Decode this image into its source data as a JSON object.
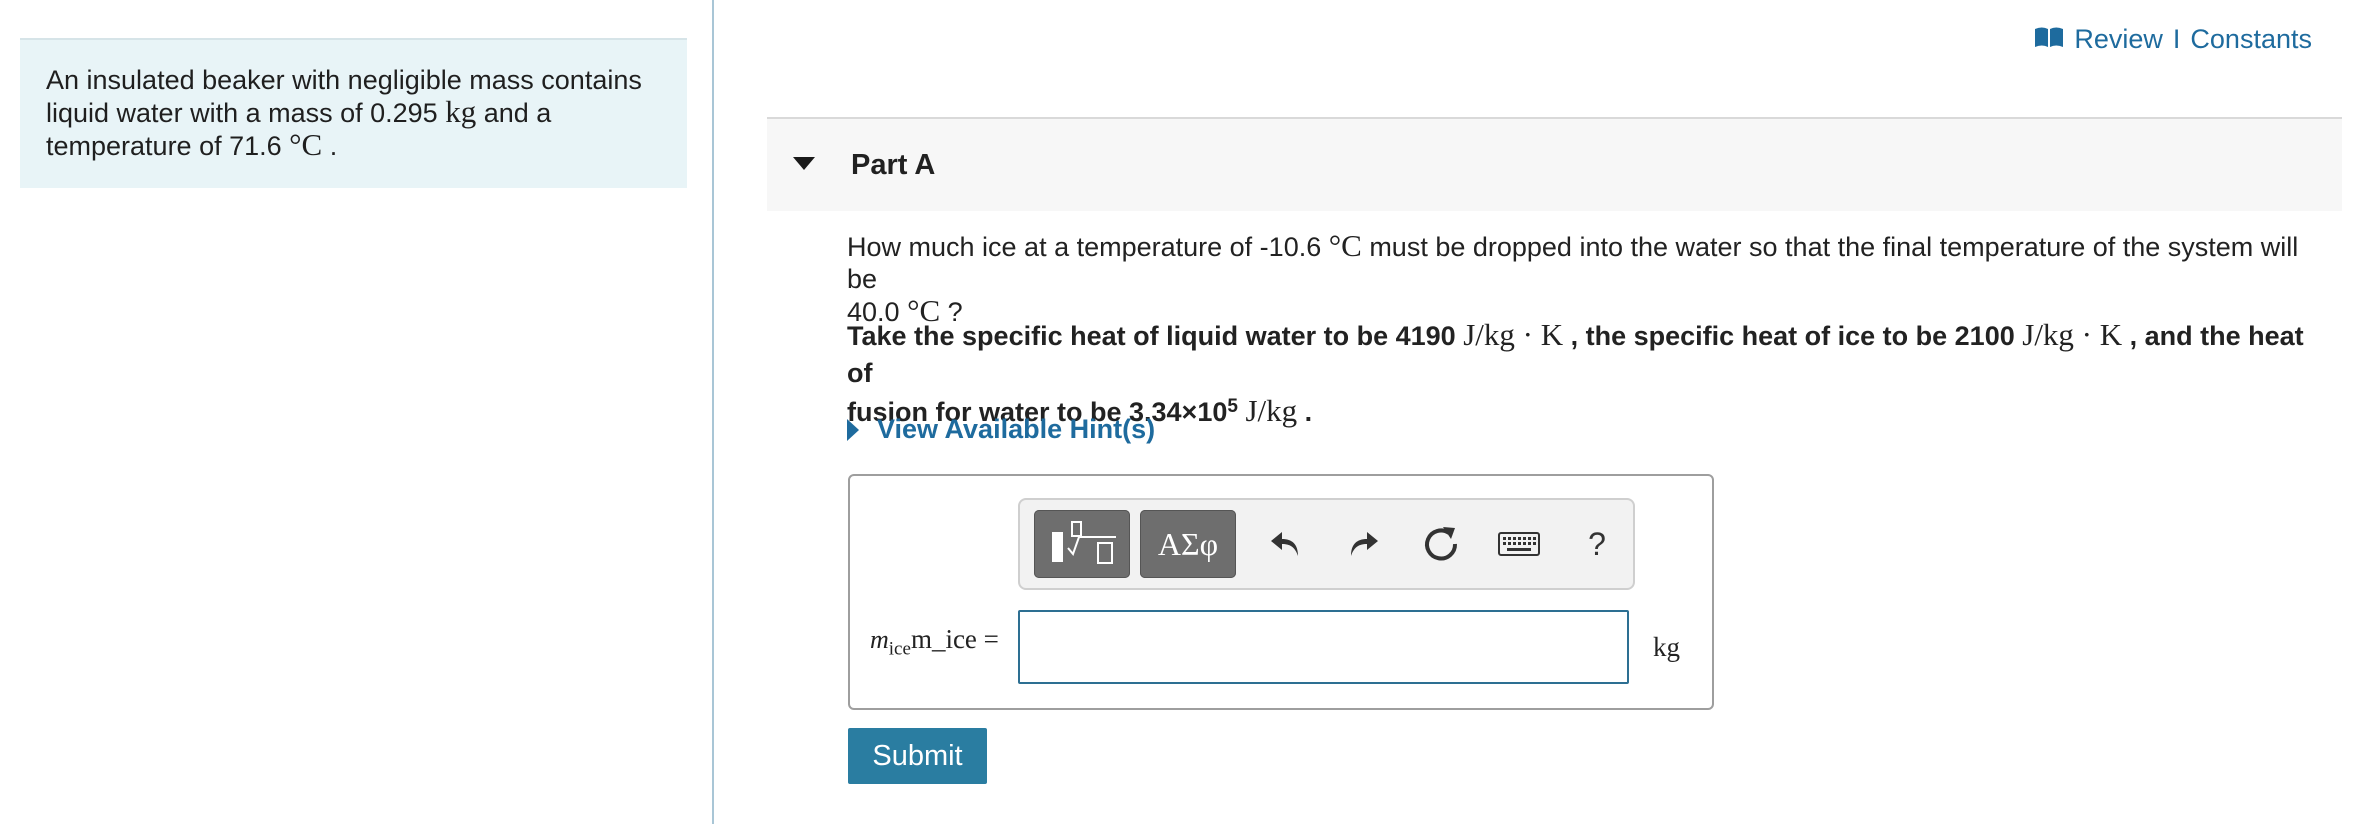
{
  "intro": {
    "line1": "An insulated beaker with negligible mass contains",
    "line2_pre": "liquid water with a mass of 0.295 ",
    "mass_unit": "kg",
    "line2_post": " and a",
    "line3_pre": "temperature of 71.6 ",
    "temp_unit": "°C",
    "line3_post": " ."
  },
  "review": {
    "review_label": "Review",
    "separator": "I",
    "constants_label": "Constants"
  },
  "part": {
    "title": "Part A"
  },
  "question": {
    "q1_pre": "How much ice at a temperature of -10.6 ",
    "q1_unit": "°C",
    "q1_mid": " must be dropped into the water so that the final temperature of the system will be",
    "q1_val2": "40.0 ",
    "q1_unit2": "°C",
    "q1_post": " ?",
    "q2_a": "Take the specific heat of liquid water to be 4190 ",
    "q2_unit1": "J/kg · K",
    "q2_b": " , the specific heat of ice to be 2100 ",
    "q2_unit2": "J/kg · K",
    "q2_c": " , and the heat of",
    "q2_d": "fusion for water to be 3.34×10",
    "q2_exp": "5",
    "q2_unit3": "J/kg",
    "q2_e": " ."
  },
  "hints": {
    "label": "View Available Hint(s)"
  },
  "toolbar": {
    "symbols_label": "ΑΣφ",
    "help_label": "?"
  },
  "answer": {
    "var_symbol": "m",
    "var_sub": "ice",
    "var_alt": "m_ice",
    "equals": " =",
    "input_value": "",
    "unit": "kg"
  },
  "submit": {
    "label": "Submit"
  },
  "colors": {
    "accent": "#1e6b9e",
    "submit_bg": "#2a7da1",
    "intro_bg": "#e8f4f7",
    "toolbar_btn": "#6e6e6e"
  }
}
